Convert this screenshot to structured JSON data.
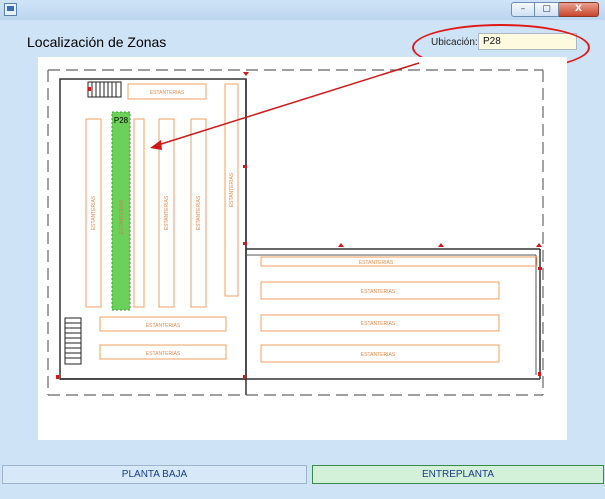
{
  "window": {
    "close_glyph": "X",
    "max_glyph": "▢",
    "min_glyph": "–",
    "icon": "app-window-icon"
  },
  "page": {
    "title": "Localización de Zonas"
  },
  "ubicacion": {
    "label": "Ubicación:",
    "value": "P28"
  },
  "map": {
    "selected_zone_label": "P28",
    "shelf_label": "ESTANTERIAS",
    "highlight_color": "#6bd15a",
    "shelf_color": "#f0a060",
    "callout_color": "#e01818"
  },
  "tabs": {
    "planta_baja": "PLANTA BAJA",
    "entreplanta": "ENTREPLANTA"
  }
}
